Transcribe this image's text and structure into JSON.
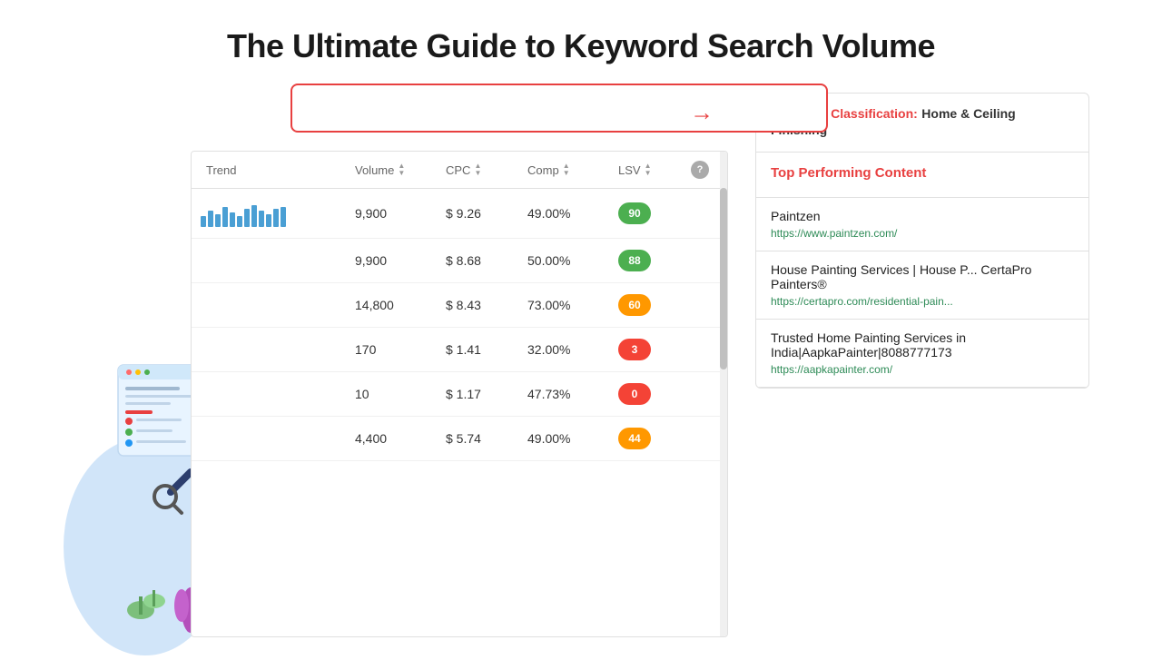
{
  "page": {
    "title": "The Ultimate Guide to Keyword Search Volume"
  },
  "searchBox": {
    "placeholder": ""
  },
  "table": {
    "headers": [
      {
        "label": "Trend",
        "sortable": false
      },
      {
        "label": "Volume",
        "sortable": true
      },
      {
        "label": "CPC",
        "sortable": true
      },
      {
        "label": "Comp",
        "sortable": true
      },
      {
        "label": "LSV",
        "sortable": true
      },
      {
        "label": "?",
        "sortable": false
      }
    ],
    "rows": [
      {
        "volume": "9,900",
        "cpc": "$ 9.26",
        "comp": "49.00%",
        "lsv": "90",
        "lsvColor": "green",
        "bars": [
          3,
          5,
          4,
          6,
          5,
          4,
          5,
          6,
          5,
          4,
          5,
          6
        ]
      },
      {
        "volume": "9,900",
        "cpc": "$ 8.68",
        "comp": "50.00%",
        "lsv": "88",
        "lsvColor": "green",
        "bars": []
      },
      {
        "volume": "14,800",
        "cpc": "$ 8.43",
        "comp": "73.00%",
        "lsv": "60",
        "lsvColor": "orange",
        "bars": []
      },
      {
        "volume": "170",
        "cpc": "$ 1.41",
        "comp": "32.00%",
        "lsv": "3",
        "lsvColor": "red",
        "bars": []
      },
      {
        "volume": "10",
        "cpc": "$ 1.17",
        "comp": "47.73%",
        "lsv": "0",
        "lsvColor": "red",
        "bars": []
      },
      {
        "volume": "4,400",
        "cpc": "$ 5.74",
        "comp": "49.00%",
        "lsv": "44",
        "lsvColor": "orange",
        "bars": []
      }
    ]
  },
  "rightPanel": {
    "semanticLabel": "Semantic Classification:",
    "semanticValue": "Home & Ceiling Finishing",
    "topContentTitle": "Top Performing Content",
    "contentItems": [
      {
        "title": "Paintzen",
        "url": "https://www.paintzen.com/"
      },
      {
        "title": "House Painting Services | House P... CertaPro Painters®",
        "url": "https://certapro.com/residential-pain..."
      },
      {
        "title": "Trusted Home Painting Services in India|AapkaPainter|8088777173",
        "url": "https://aapkapainter.com/"
      }
    ]
  }
}
